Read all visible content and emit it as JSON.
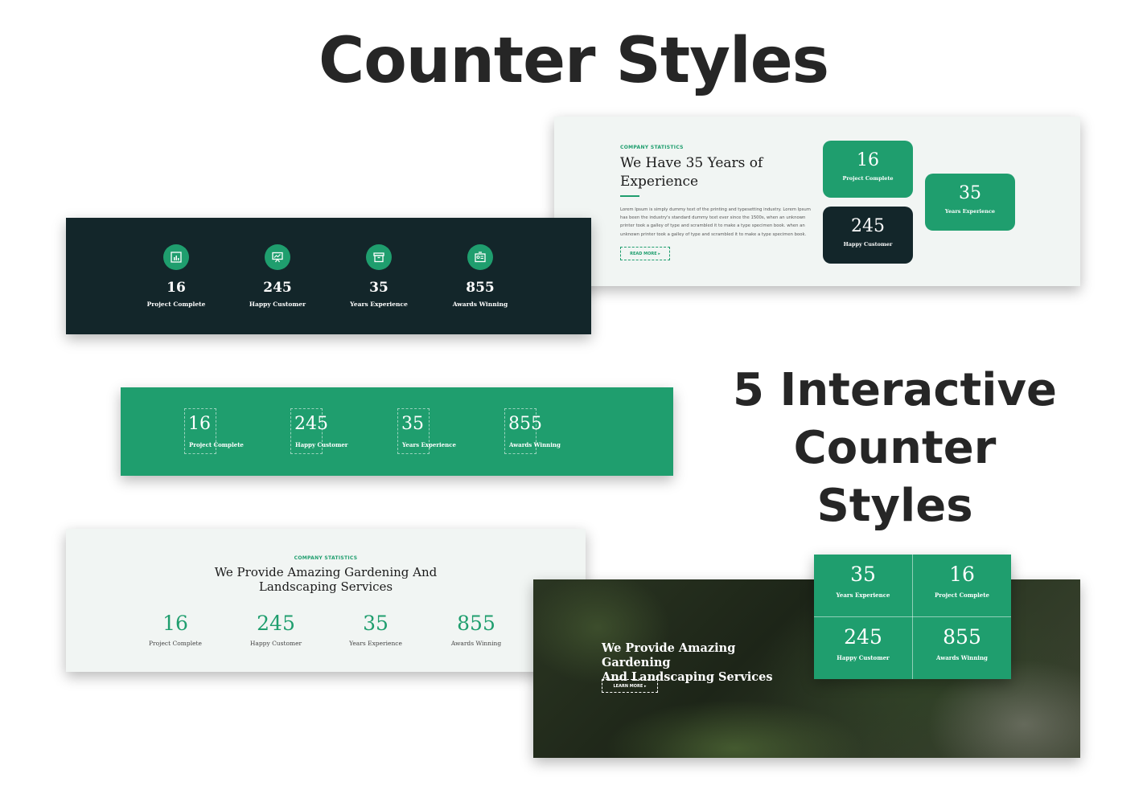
{
  "main_title": "Counter Styles",
  "side_title": [
    "5 Interactive",
    "Counter Styles"
  ],
  "colors": {
    "accent": "#1f9e6e",
    "dark": "#13262a",
    "light_bg": "#f1f5f3"
  },
  "style1": {
    "items": [
      {
        "value": "16",
        "label": "Project Complete",
        "icon": "chart-icon"
      },
      {
        "value": "245",
        "label": "Happy Customer",
        "icon": "presentation-icon"
      },
      {
        "value": "35",
        "label": "Years Experience",
        "icon": "archive-icon"
      },
      {
        "value": "855",
        "label": "Awards Winning",
        "icon": "certificate-icon"
      }
    ]
  },
  "style2": {
    "eyebrow": "COMPANY STATISTICS",
    "heading": "We Have 35 Years of Experience",
    "body": "Lorem Ipsum is simply dummy text of the printing and typesetting industry. Lorem Ipsum has been the industry's standard dummy text ever since the 1500s, when an unknown printer took a galley of type and scrambled it to make a type specimen book. when an unknown printer took a galley of type and scrambled it to make a type specimen book.",
    "button": "READ MORE ▸",
    "cards": [
      {
        "value": "16",
        "label": "Project Complete"
      },
      {
        "value": "35",
        "label": "Years Experience"
      },
      {
        "value": "245",
        "label": "Happy Customer"
      }
    ]
  },
  "style3": {
    "items": [
      {
        "value": "16",
        "label": "Project Complete"
      },
      {
        "value": "245",
        "label": "Happy Customer"
      },
      {
        "value": "35",
        "label": "Years Experience"
      },
      {
        "value": "855",
        "label": "Awards Winning"
      }
    ]
  },
  "style4": {
    "eyebrow": "COMPANY STATISTICS",
    "heading_line1": "We Provide Amazing Gardening And",
    "heading_line2": "Landscaping Services",
    "items": [
      {
        "value": "16",
        "label": "Project Complete"
      },
      {
        "value": "245",
        "label": "Happy Customer"
      },
      {
        "value": "35",
        "label": "Years Experience"
      },
      {
        "value": "855",
        "label": "Awards Winning"
      }
    ]
  },
  "style5": {
    "heading_line1": "We Provide Amazing Gardening",
    "heading_line2": "And Landscaping Services",
    "button": "LEARN MORE ▸",
    "cells": [
      {
        "value": "35",
        "label": "Years Experience"
      },
      {
        "value": "16",
        "label": "Project Complete"
      },
      {
        "value": "245",
        "label": "Happy Customer"
      },
      {
        "value": "855",
        "label": "Awards Winning"
      }
    ]
  }
}
